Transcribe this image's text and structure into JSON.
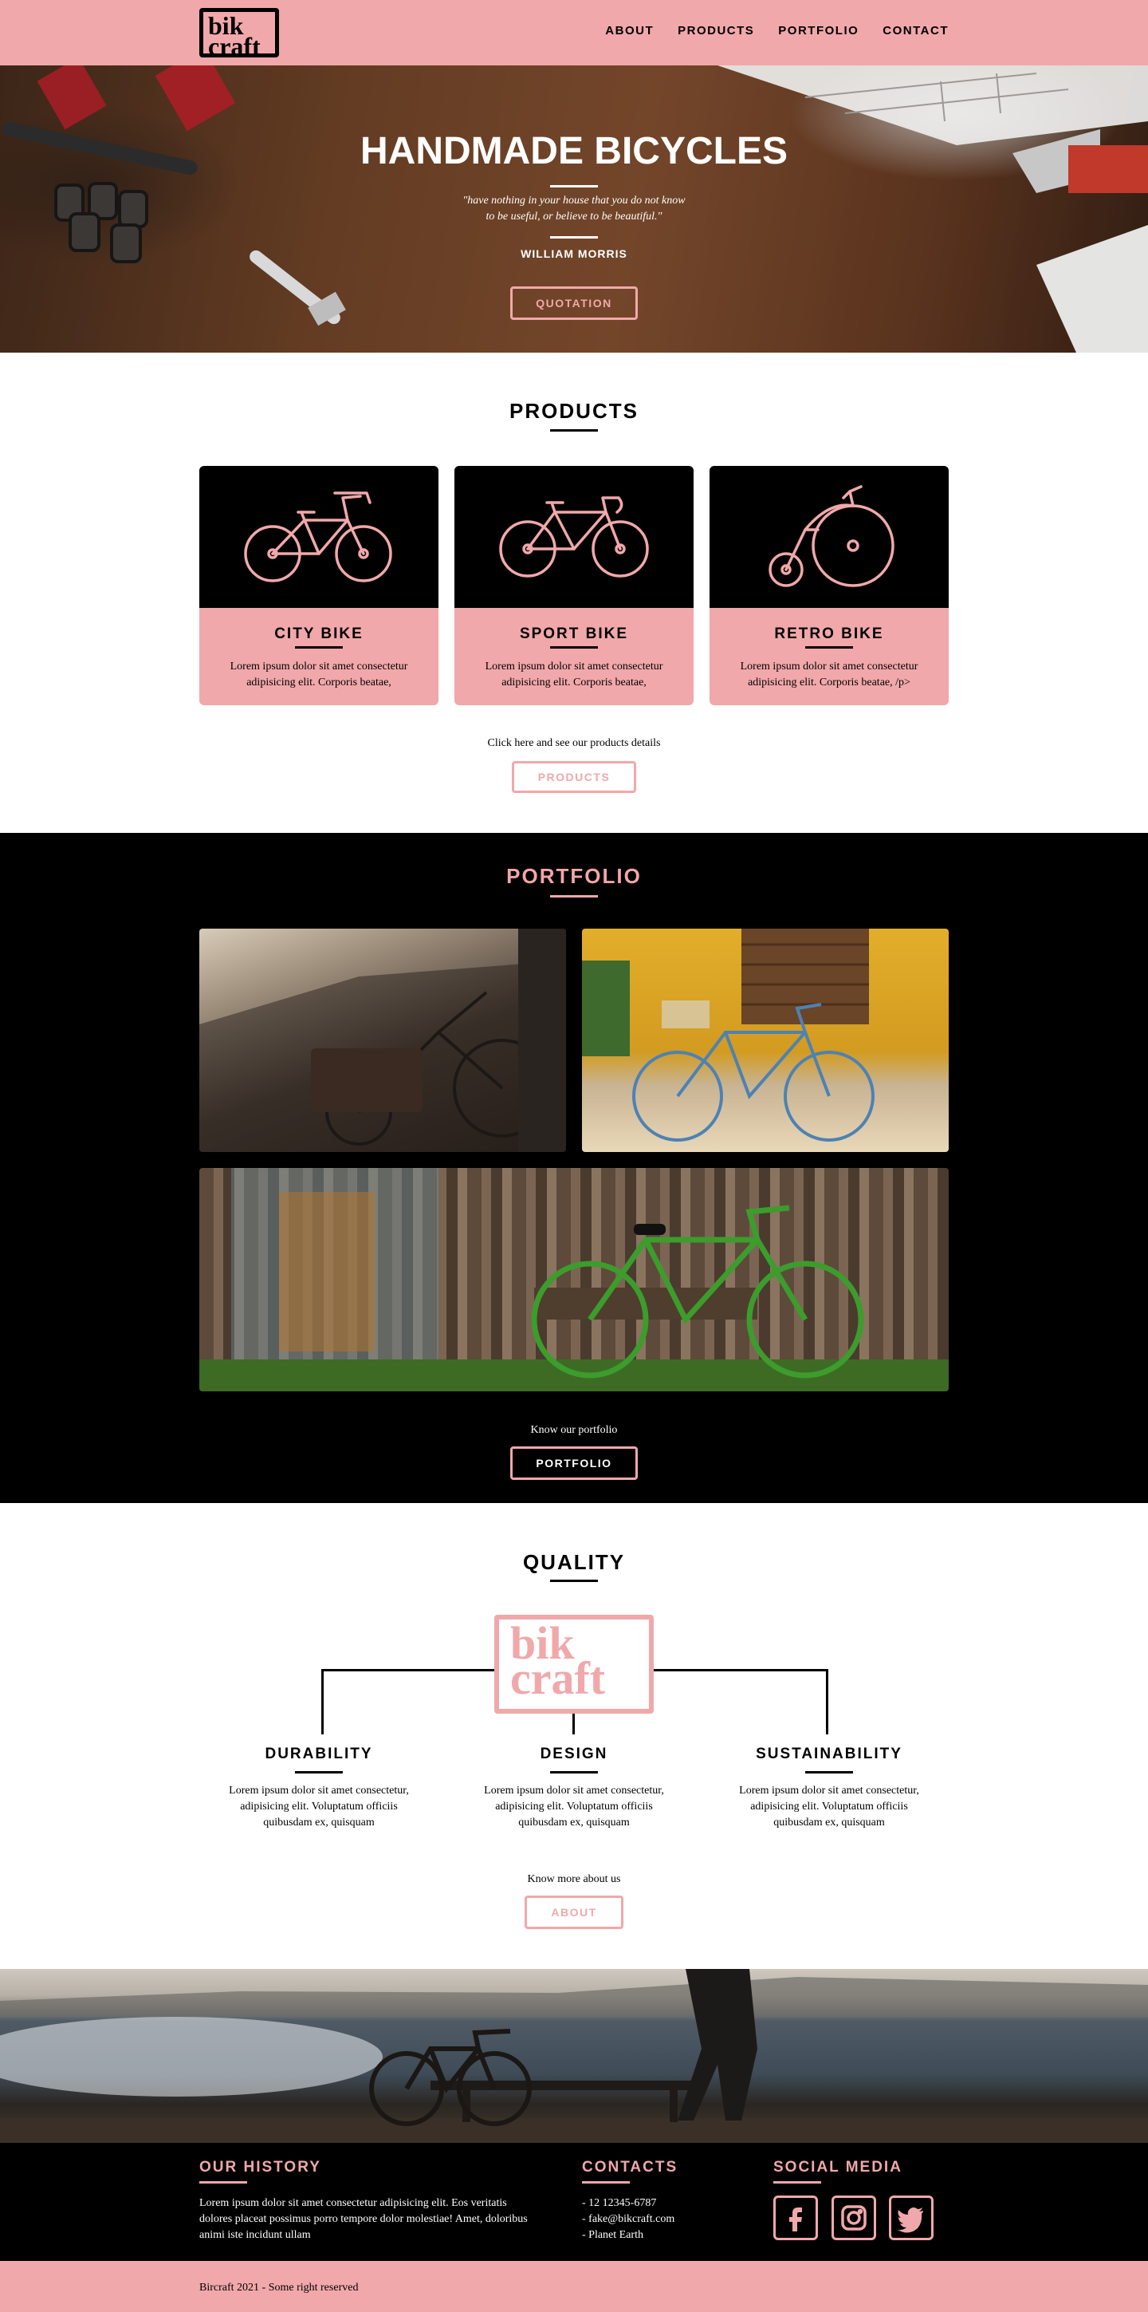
{
  "brand": {
    "logo_line1": "bik",
    "logo_line2": "craft",
    "accent": "#f1a8aa"
  },
  "nav": [
    "ABOUT",
    "PRODUCTS",
    "PORTFOLIO",
    "CONTACT"
  ],
  "hero": {
    "title": "HANDMADE BICYCLES",
    "quote_line1": "\"have nothing in your house that you do not know",
    "quote_line2": "to be useful, or believe to be beautiful.\"",
    "author": "WILLIAM MORRIS",
    "button": "QUOTATION"
  },
  "products": {
    "title": "PRODUCTS",
    "cards": [
      {
        "name": "CITY BIKE",
        "text": "Lorem ipsum dolor sit amet consectetur adipisicing elit. Corporis beatae,",
        "icon": "city-bike-icon"
      },
      {
        "name": "SPORT BIKE",
        "text": "Lorem ipsum dolor sit amet consectetur adipisicing elit. Corporis beatae,",
        "icon": "sport-bike-icon"
      },
      {
        "name": "RETRO BIKE",
        "text": "Lorem ipsum dolor sit amet consectetur adipisicing elit. Corporis beatae, /p>",
        "icon": "retro-bike-icon"
      }
    ],
    "note": "Click here and see our products details",
    "button": "PRODUCTS"
  },
  "portfolio": {
    "title": "PORTFOLIO",
    "note": "Know our portfolio",
    "button": "PORTFOLIO"
  },
  "quality": {
    "title": "QUALITY",
    "logo_line1": "bik",
    "logo_line2": "craft",
    "columns": [
      {
        "name": "DURABILITY",
        "text": "Lorem ipsum dolor sit amet consectetur, adipisicing elit. Voluptatum officiis quibusdam ex, quisquam"
      },
      {
        "name": "DESIGN",
        "text": "Lorem ipsum dolor sit amet consectetur, adipisicing elit. Voluptatum officiis quibusdam ex, quisquam"
      },
      {
        "name": "SUSTAINABILITY",
        "text": "Lorem ipsum dolor sit amet consectetur, adipisicing elit. Voluptatum officiis quibusdam ex, quisquam"
      }
    ],
    "note": "Know more about us",
    "button": "ABOUT"
  },
  "footer": {
    "history_title": "OUR HISTORY",
    "history_text": "Lorem ipsum dolor sit amet consectetur adipisicing elit. Eos veritatis dolores placeat possimus porro tempore dolor molestiae! Amet, doloribus animi iste incidunt ullam",
    "contacts_title": "CONTACTS",
    "contacts": [
      "- 12 12345-6787",
      "- fake@bikcraft.com",
      "- Planet Earth"
    ],
    "social_title": "SOCIAL MEDIA",
    "social": [
      "facebook-icon",
      "instagram-icon",
      "twitter-icon"
    ],
    "copyright": "Bircraft 2021 - Some right reserved"
  }
}
